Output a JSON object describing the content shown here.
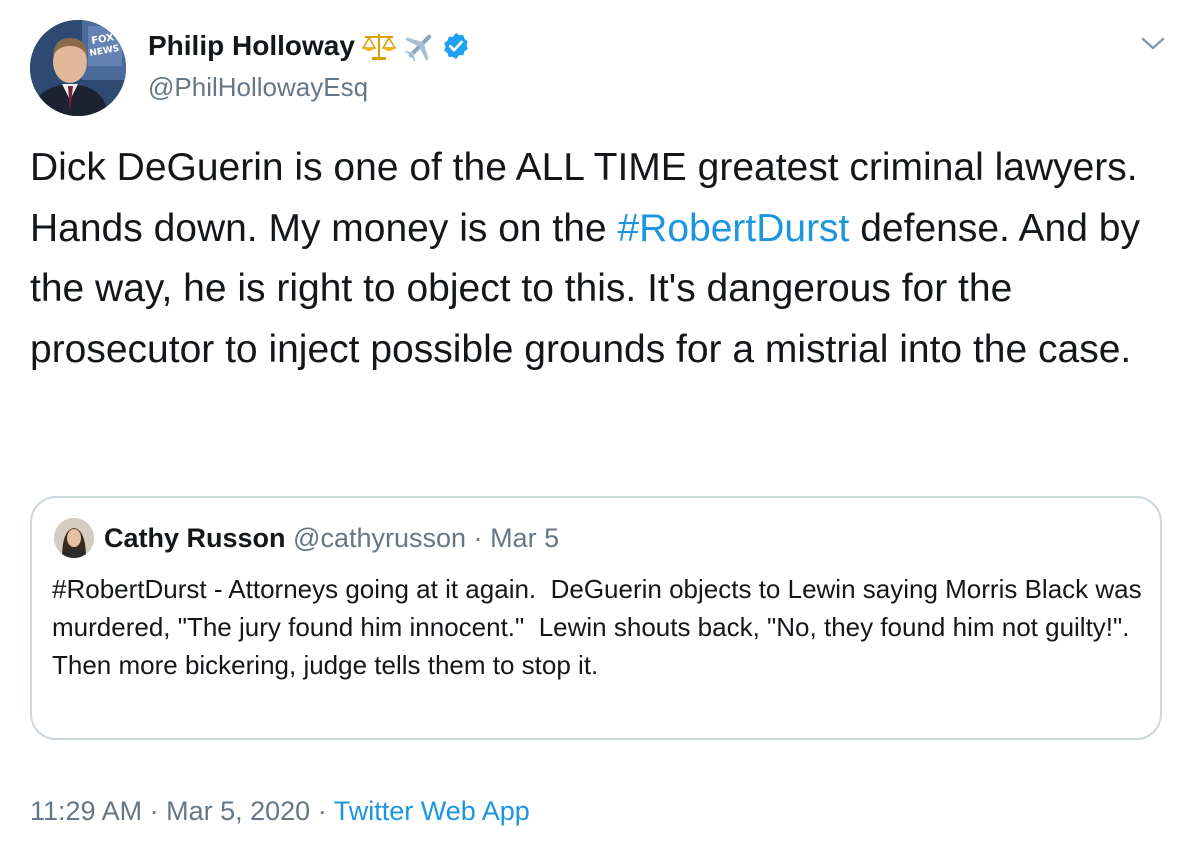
{
  "author": {
    "display_name": "Philip Holloway",
    "handle": "@PhilHollowayEsq",
    "name_emojis": [
      "scales-emoji",
      "airplane-emoji"
    ],
    "verified": true,
    "avatar_badge_text": "FOX NEWS"
  },
  "tweet": {
    "text_before": "Dick DeGuerin is one of the ALL TIME greatest criminal lawyers. Hands down. My money is on the ",
    "hashtag": "#RobertDurst",
    "text_after": " defense. And by the way, he is right to object to this. It's dangerous for the prosecutor to inject possible grounds for a mistrial into the case."
  },
  "quoted_tweet": {
    "display_name": "Cathy Russon",
    "handle": "@cathyrusson",
    "separator": "·",
    "date": "Mar 5",
    "text": "#RobertDurst - Attorneys going at it again.  DeGuerin objects to Lewin saying Morris Black was murdered, \"The jury found him innocent.\"  Lewin shouts back, \"No, they found him not guilty!\".  Then more bickering, judge tells them to stop it."
  },
  "footer": {
    "time": "11:29 AM",
    "separator": "·",
    "date": "Mar 5, 2020",
    "source": "Twitter Web App"
  },
  "colors": {
    "link": "#1b95e0",
    "secondary_text": "#657786",
    "primary_text": "#14171a",
    "verified_badge": "#1da1f2",
    "card_border": "#ccd6dd"
  },
  "icons": {
    "menu": "chevron-down-icon",
    "verified": "verified-badge-icon"
  }
}
